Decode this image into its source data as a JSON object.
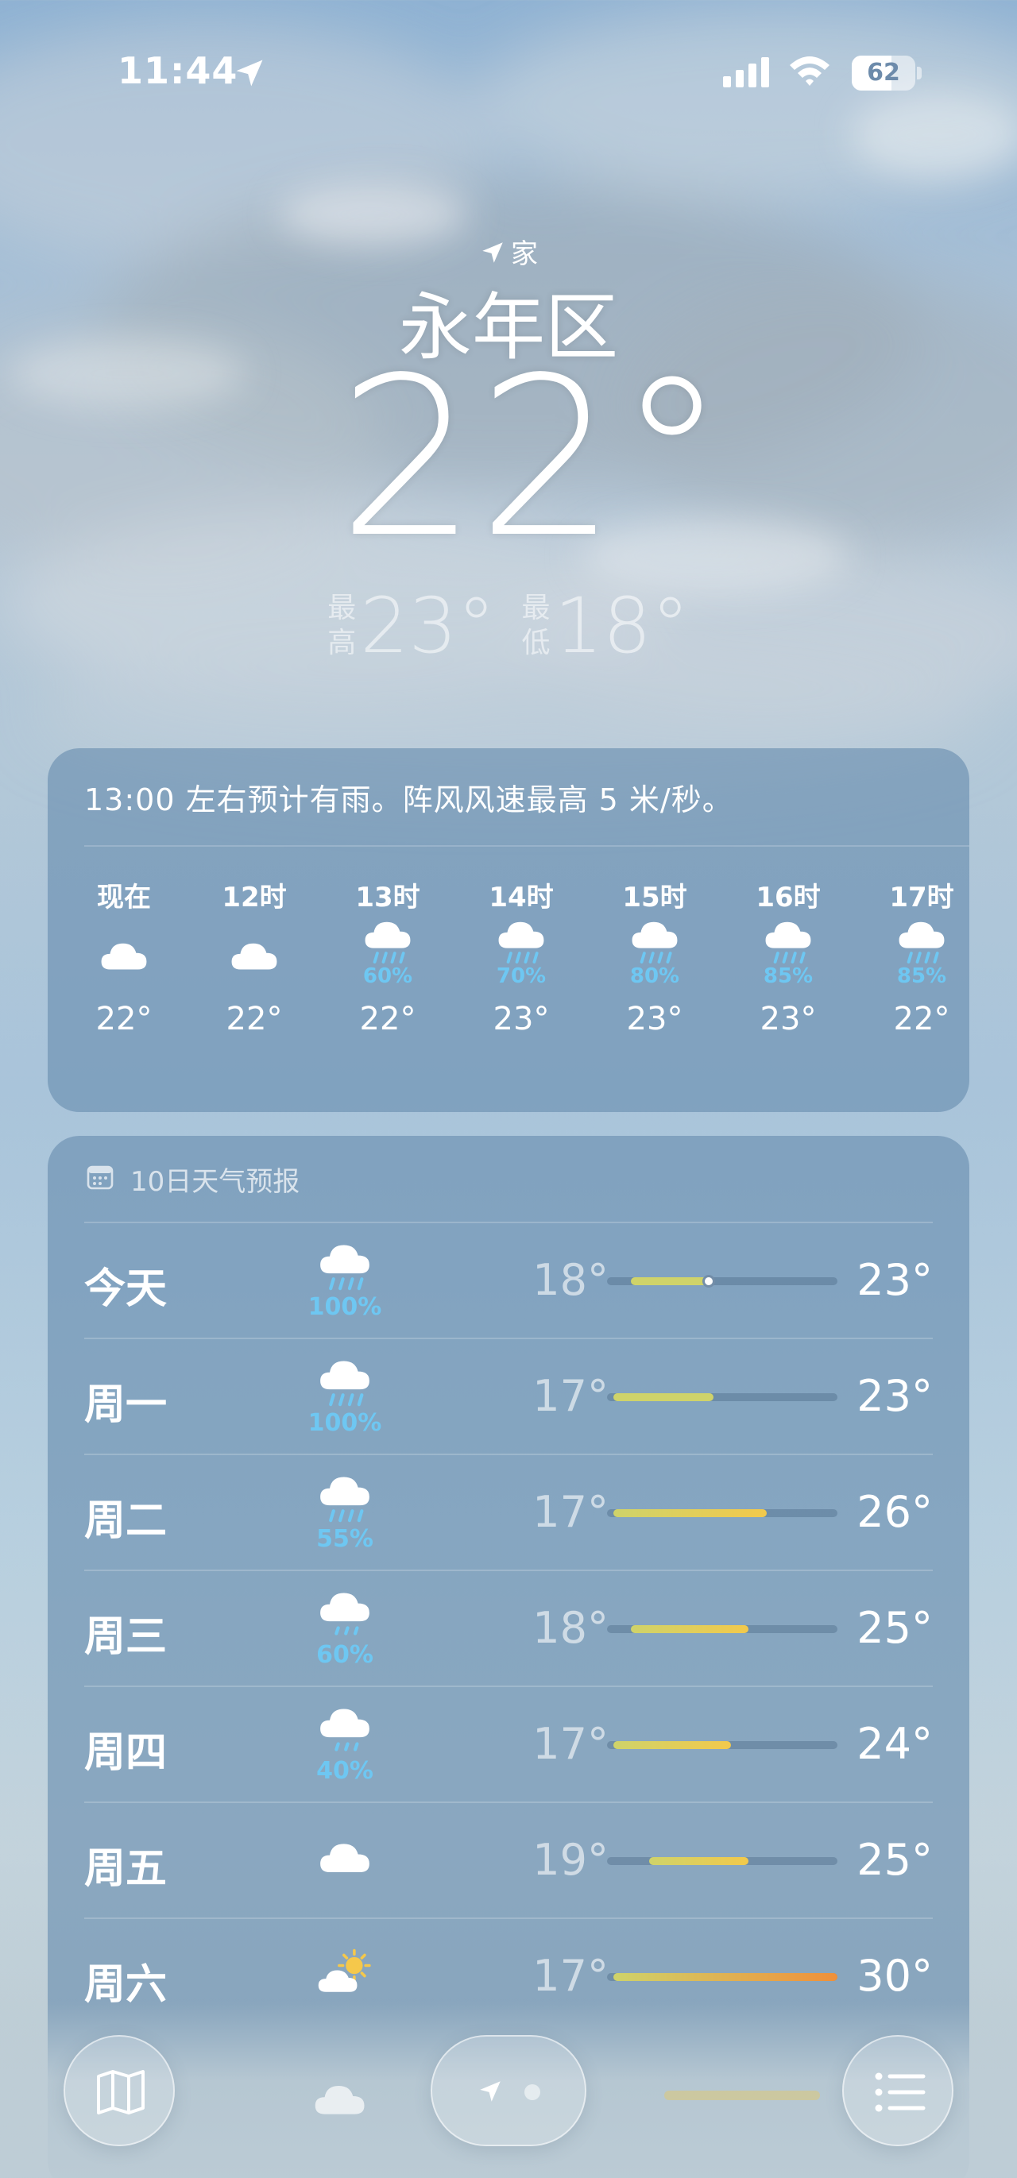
{
  "status_bar": {
    "time": "11:44",
    "battery_level": "62",
    "battery_fraction": 0.62,
    "icons": [
      "location-arrow-icon",
      "cellular-signal-icon",
      "wifi-icon",
      "battery-icon"
    ]
  },
  "header": {
    "location_tag": "家",
    "location_icon": "location-arrow-icon",
    "city": "永年区",
    "current_temp": "22°",
    "high_label": "最高",
    "high_temp": "23°",
    "low_label": "最低",
    "low_temp": "18°"
  },
  "hourly": {
    "summary": "13:00 左右预计有雨。阵风风速最高 5 米/秒。",
    "hours": [
      {
        "label": "现在",
        "icon": "cloud-icon",
        "pop": "",
        "temp": "22°"
      },
      {
        "label": "12时",
        "icon": "cloud-icon",
        "pop": "",
        "temp": "22°"
      },
      {
        "label": "13时",
        "icon": "cloud-rain-icon",
        "pop": "60%",
        "temp": "22°"
      },
      {
        "label": "14时",
        "icon": "cloud-rain-icon",
        "pop": "70%",
        "temp": "23°"
      },
      {
        "label": "15时",
        "icon": "cloud-rain-icon",
        "pop": "80%",
        "temp": "23°"
      },
      {
        "label": "16时",
        "icon": "cloud-rain-icon",
        "pop": "85%",
        "temp": "23°"
      },
      {
        "label": "17时",
        "icon": "cloud-rain-icon",
        "pop": "85%",
        "temp": "22°"
      }
    ]
  },
  "daily": {
    "title": "10日天气预报",
    "title_icon": "calendar-icon",
    "range_min": 17,
    "range_max": 30,
    "current_temp_value": 22,
    "days": [
      {
        "name": "今天",
        "icon": "cloud-rain-icon",
        "pop": "100%",
        "low": "18°",
        "high": "23°",
        "low_value": 18,
        "high_value": 23,
        "show_current": true
      },
      {
        "name": "周一",
        "icon": "cloud-rain-icon",
        "pop": "100%",
        "low": "17°",
        "high": "23°",
        "low_value": 17,
        "high_value": 23,
        "show_current": false
      },
      {
        "name": "周二",
        "icon": "cloud-rain-icon",
        "pop": "55%",
        "low": "17°",
        "high": "26°",
        "low_value": 17,
        "high_value": 26,
        "show_current": false
      },
      {
        "name": "周三",
        "icon": "cloud-drizzle-icon",
        "pop": "60%",
        "low": "18°",
        "high": "25°",
        "low_value": 18,
        "high_value": 25,
        "show_current": false
      },
      {
        "name": "周四",
        "icon": "cloud-drizzle-icon",
        "pop": "40%",
        "low": "17°",
        "high": "24°",
        "low_value": 17,
        "high_value": 24,
        "show_current": false
      },
      {
        "name": "周五",
        "icon": "cloud-icon",
        "pop": "",
        "low": "19°",
        "high": "25°",
        "low_value": 19,
        "high_value": 25,
        "show_current": false
      },
      {
        "name": "周六",
        "icon": "partly-sunny-icon",
        "pop": "",
        "low": "17°",
        "high": "30°",
        "low_value": 17,
        "high_value": 30,
        "show_current": false
      }
    ]
  },
  "toolbar": {
    "items": [
      "map-icon",
      "location-arrow-icon",
      "page-dot-icon",
      "list-icon"
    ]
  },
  "colors": {
    "card_background": "#688daf",
    "precipitation_text": "#6ec7f2",
    "bar_cool": "#cfd36a",
    "bar_warm": "#f2c94c",
    "bar_hot": "#f0903a"
  }
}
